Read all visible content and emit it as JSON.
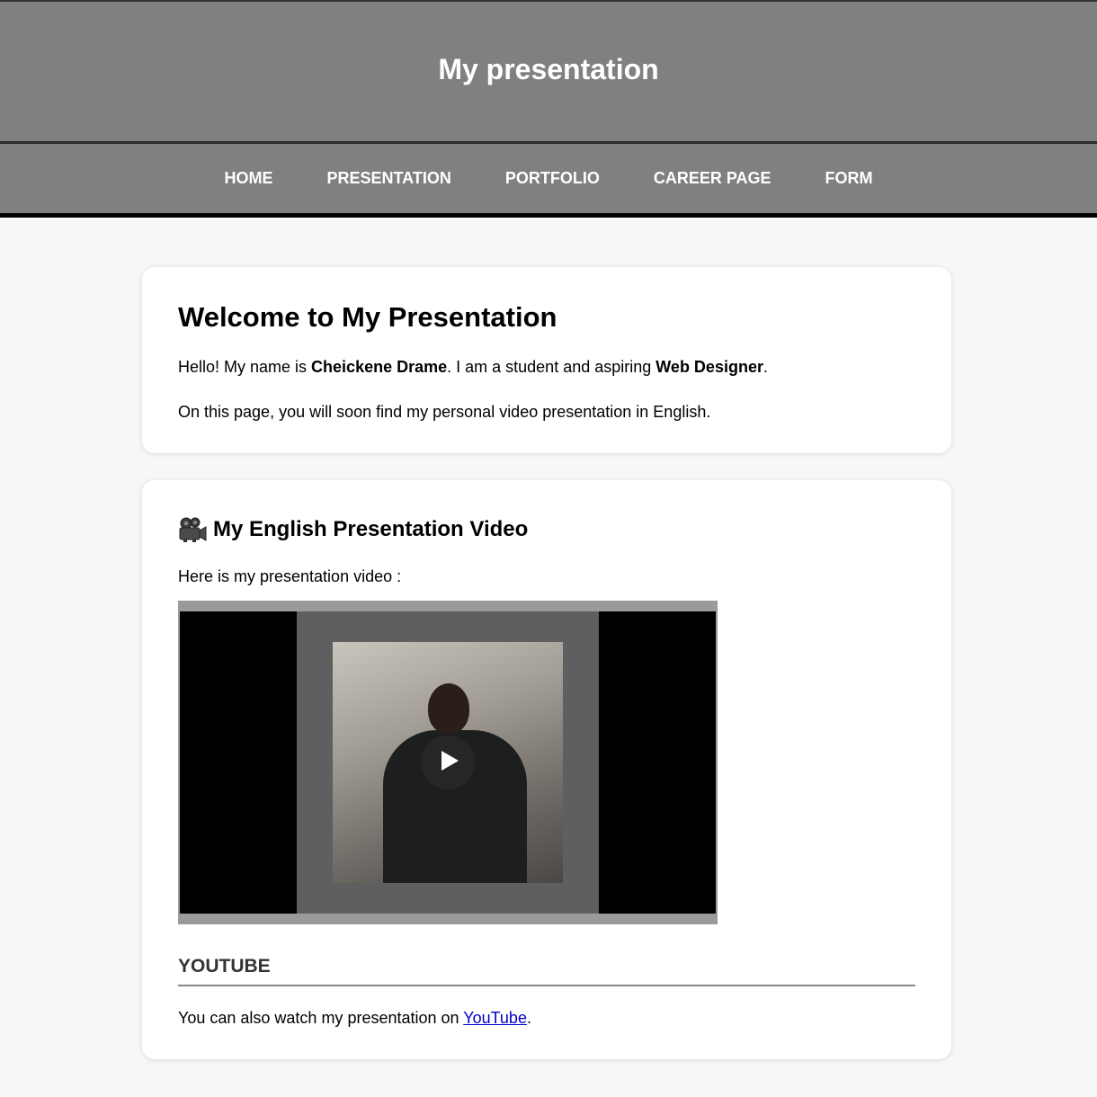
{
  "header": {
    "title": "My presentation"
  },
  "nav": {
    "items": [
      {
        "label": "HOME"
      },
      {
        "label": "PRESENTATION"
      },
      {
        "label": "PORTFOLIO"
      },
      {
        "label": "CAREER PAGE"
      },
      {
        "label": "FORM"
      }
    ]
  },
  "welcome": {
    "title": "Welcome to My Presentation",
    "hello_prefix": "Hello! My name is ",
    "name": "Cheickene Drame",
    "hello_middle": ". I am a student and aspiring ",
    "role": "Web Designer",
    "hello_suffix": ".",
    "soon": "On this page, you will soon find my personal video presentation in English."
  },
  "video_section": {
    "icon": "movie-camera-icon",
    "title": "My English Presentation Video",
    "intro": "Here is my presentation video :",
    "play_icon": "play-icon"
  },
  "youtube": {
    "heading": "YOUTUBE",
    "text_prefix": "You can also watch my presentation on ",
    "link_label": "YouTube",
    "text_suffix": "."
  },
  "colors": {
    "header_bg": "#808080",
    "page_bg": "#f7f7f7",
    "link": "#0000cc"
  }
}
